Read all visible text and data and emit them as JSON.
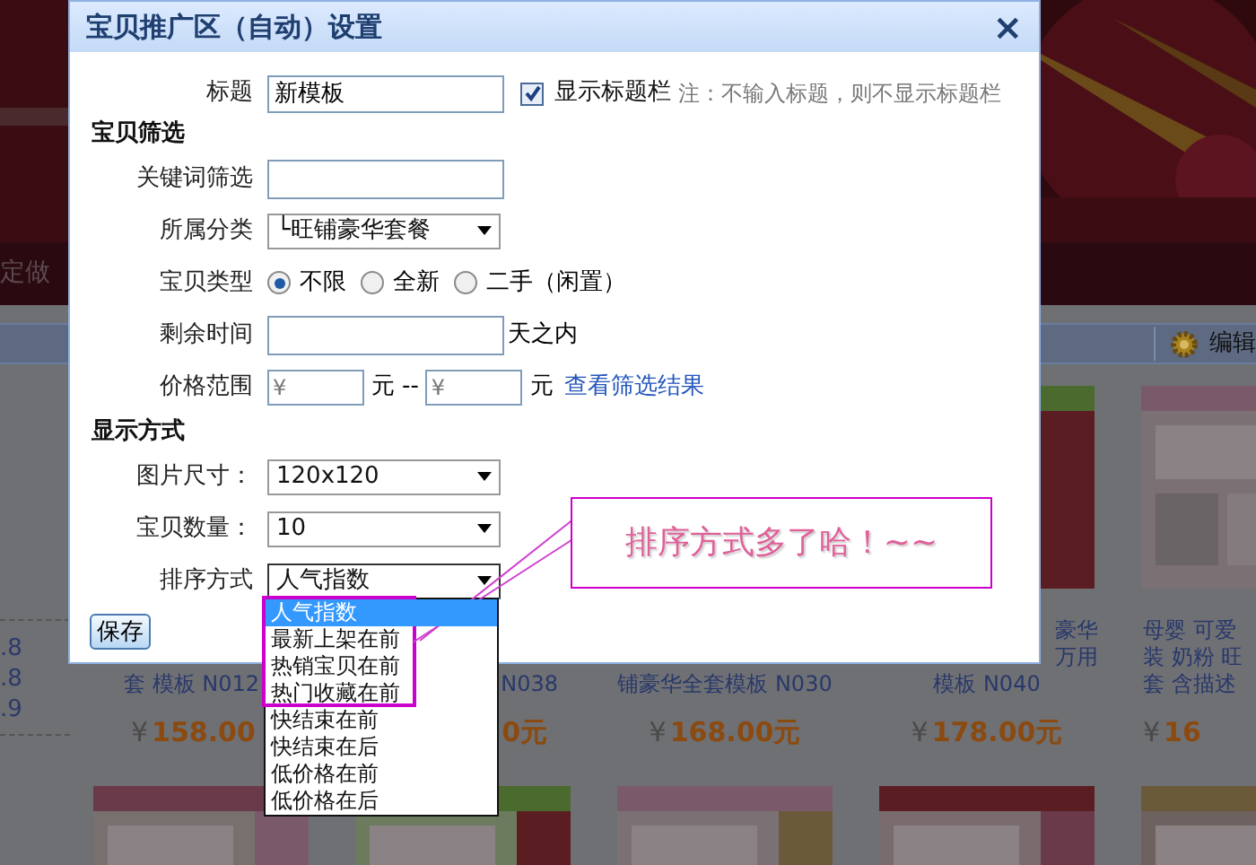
{
  "dialog": {
    "title": "宝贝推广区（自动）设置",
    "close": "×"
  },
  "title_row": {
    "label": "标题",
    "value": "新模板",
    "show_title": {
      "label": "显示标题栏",
      "checked": true
    },
    "note": "注：不输入标题，则不显示标题栏"
  },
  "sections": [
    {
      "heading": "宝贝筛选",
      "rows": [
        {
          "kind": "input",
          "label": "关键词筛选"
        },
        {
          "kind": "select",
          "label": "所属分类",
          "value": "└旺铺豪华套餐",
          "expanded": false
        },
        {
          "kind": "radio",
          "label": "宝贝类型",
          "options": [
            {
              "label": "不限",
              "selected": true
            },
            {
              "label": "全新",
              "selected": false
            },
            {
              "label": "二手（闲置）",
              "selected": false
            }
          ]
        },
        {
          "kind": "input",
          "label": "剩余时间",
          "suffix": "天之内"
        },
        {
          "kind": "range",
          "label": "价格范围",
          "min_placeholder": "¥",
          "unit": "元",
          "separator": "--",
          "max_placeholder": "¥",
          "max_unit": "元",
          "link": "查看筛选结果"
        }
      ]
    },
    {
      "heading": "显示方式",
      "rows": [
        {
          "kind": "select",
          "label": "图片尺寸：",
          "value": "120x120",
          "expanded": false
        },
        {
          "kind": "select",
          "label": "宝贝数量：",
          "value": "10",
          "expanded": false
        },
        {
          "kind": "select",
          "label": "排序方式",
          "value": "人气指数",
          "expanded": true,
          "options": [
            {
              "label": "人气指数",
              "selected": true
            },
            {
              "label": "最新上架在前",
              "selected": false
            },
            {
              "label": "热销宝贝在前",
              "selected": false
            },
            {
              "label": "热门收藏在前",
              "selected": false
            },
            {
              "label": "快结束在前",
              "selected": false
            },
            {
              "label": "快结束在后",
              "selected": false
            },
            {
              "label": "低价格在前",
              "selected": false
            },
            {
              "label": "低价格在后",
              "selected": false
            }
          ]
        }
      ]
    }
  ],
  "save_button": "保存",
  "callout": {
    "text": "排序方式多了哈！~~"
  },
  "background": {
    "nav_item": "定做",
    "toolbar_button": "编辑",
    "ratings": [
      ".8",
      ".8",
      ".9"
    ],
    "products": [
      {
        "lines": [
          "套 模板 N012"
        ],
        "currency": "¥",
        "price": "158.00"
      },
      {
        "lines": [
          "N038"
        ],
        "price": "0元"
      },
      {
        "lines": [
          "铺豪华全套模板 N030"
        ],
        "currency": "¥",
        "price": "168.00元"
      },
      {
        "lines": [
          "豪华",
          "万用",
          "模板 N040"
        ],
        "currency": "¥",
        "price": "178.00元"
      },
      {
        "lines": [
          "母婴 可爱",
          "装 奶粉 旺",
          "套 含描述"
        ],
        "currency": "¥",
        "price": "16"
      }
    ]
  }
}
